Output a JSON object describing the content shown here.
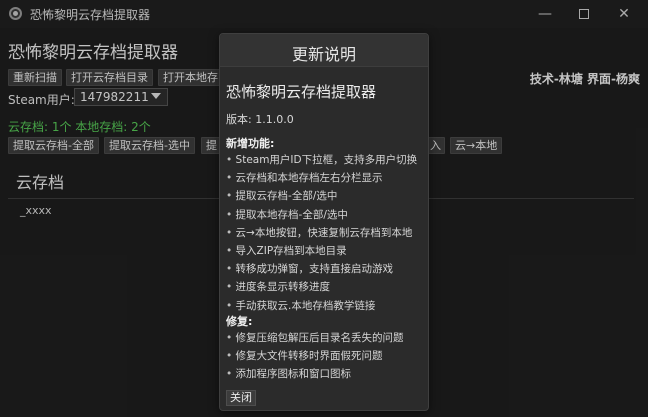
{
  "window": {
    "title": "恐怖黎明云存档提取器",
    "controls": {
      "minimize": "—",
      "close": "✕"
    }
  },
  "app": {
    "heading": "恐怖黎明云存档提取器",
    "credits": "技术-林塘   界面-杨爽"
  },
  "toolbar": {
    "row1": [
      "重新扫描",
      "打开云存档目录",
      "打开本地存"
    ],
    "row2_left": [
      "提取云存档-全部",
      "提取云存档-选中",
      "提"
    ],
    "row2_right": [
      "入",
      "云→本地"
    ]
  },
  "steam": {
    "label": "Steam用户:",
    "selected": "147982211"
  },
  "counts": "云存档: 1个   本地存档: 2个",
  "cloud_section": {
    "title": "云存档",
    "items": [
      "_xxxx"
    ]
  },
  "dialog": {
    "title": "更新说明",
    "app_name": "恐怖黎明云存档提取器",
    "version": "版本: 1.1.0.0",
    "features_heading": "新增功能:",
    "features": [
      "Steam用户ID下拉框，支持多用户切换",
      "云存档和本地存档左右分栏显示",
      "提取云存档-全部/选中",
      "提取本地存档-全部/选中",
      "云→本地按钮，快速复制云存档到本地",
      "导入ZIP存档到本地目录",
      "转移成功弹窗，支持直接启动游戏",
      "进度条显示转移进度",
      "手动获取云.本地存档教学链接"
    ],
    "fixes_heading": "修复:",
    "fixes": [
      "修复压缩包解压后目录名丢失的问题",
      "修复大文件转移时界面假死问题",
      "添加程序图标和窗口图标"
    ],
    "close_label": "关闭"
  }
}
